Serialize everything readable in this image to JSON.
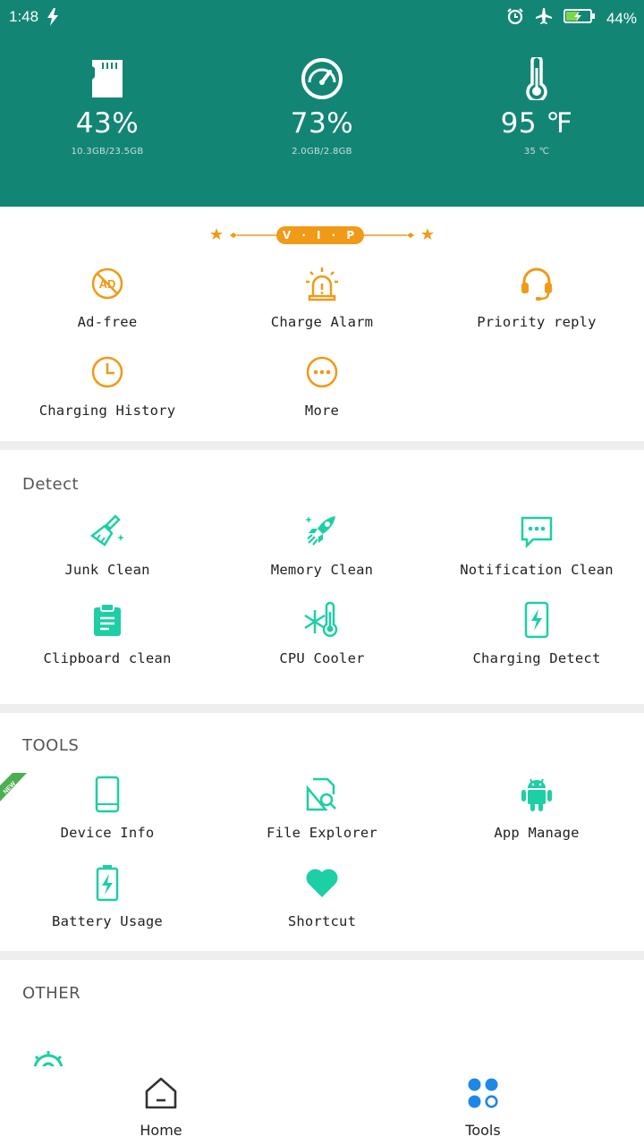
{
  "status_bar": {
    "time": "1:48",
    "battery": "44%"
  },
  "stats": [
    {
      "value": "43%",
      "sub": "10.3GB/23.5GB",
      "icon": "sd-card-icon"
    },
    {
      "value": "73%",
      "sub": "2.0GB/2.8GB",
      "icon": "gauge-icon"
    },
    {
      "value": "95 ℉",
      "sub": "35 ℃",
      "icon": "thermometer-icon"
    }
  ],
  "vip": {
    "label": "V · I · P",
    "items": [
      {
        "label": "Ad-free",
        "icon": "ad-free-icon"
      },
      {
        "label": "Charge Alarm",
        "icon": "alarm-light-icon"
      },
      {
        "label": "Priority reply",
        "icon": "headset-icon"
      },
      {
        "label": "Charging History",
        "icon": "clock-icon"
      },
      {
        "label": "More",
        "icon": "more-icon"
      }
    ]
  },
  "detect": {
    "title": "Detect",
    "items": [
      {
        "label": "Junk Clean",
        "icon": "broom-icon"
      },
      {
        "label": "Memory Clean",
        "icon": "rocket-icon"
      },
      {
        "label": "Notification Clean",
        "icon": "chat-bubble-icon"
      },
      {
        "label": "Clipboard clean",
        "icon": "clipboard-icon"
      },
      {
        "label": "CPU Cooler",
        "icon": "snowflake-thermometer-icon"
      },
      {
        "label": "Charging Detect",
        "icon": "phone-charging-icon"
      }
    ]
  },
  "tools": {
    "title": "TOOLS",
    "new_badge": "NEW",
    "items": [
      {
        "label": "Device Info",
        "icon": "phone-icon"
      },
      {
        "label": "File Explorer",
        "icon": "file-search-icon"
      },
      {
        "label": "App Manage",
        "icon": "android-icon"
      },
      {
        "label": "Battery Usage",
        "icon": "battery-bolt-icon"
      },
      {
        "label": "Shortcut",
        "icon": "heart-icon"
      }
    ]
  },
  "other": {
    "title": "OTHER"
  },
  "bottom_nav": [
    {
      "label": "Home",
      "icon": "home-icon"
    },
    {
      "label": "Tools",
      "icon": "tools-grid-icon"
    }
  ],
  "colors": {
    "header": "#138574",
    "accent_teal": "#1ccfa5",
    "accent_orange": "#f09a17",
    "tools_blue": "#1f88e5"
  }
}
